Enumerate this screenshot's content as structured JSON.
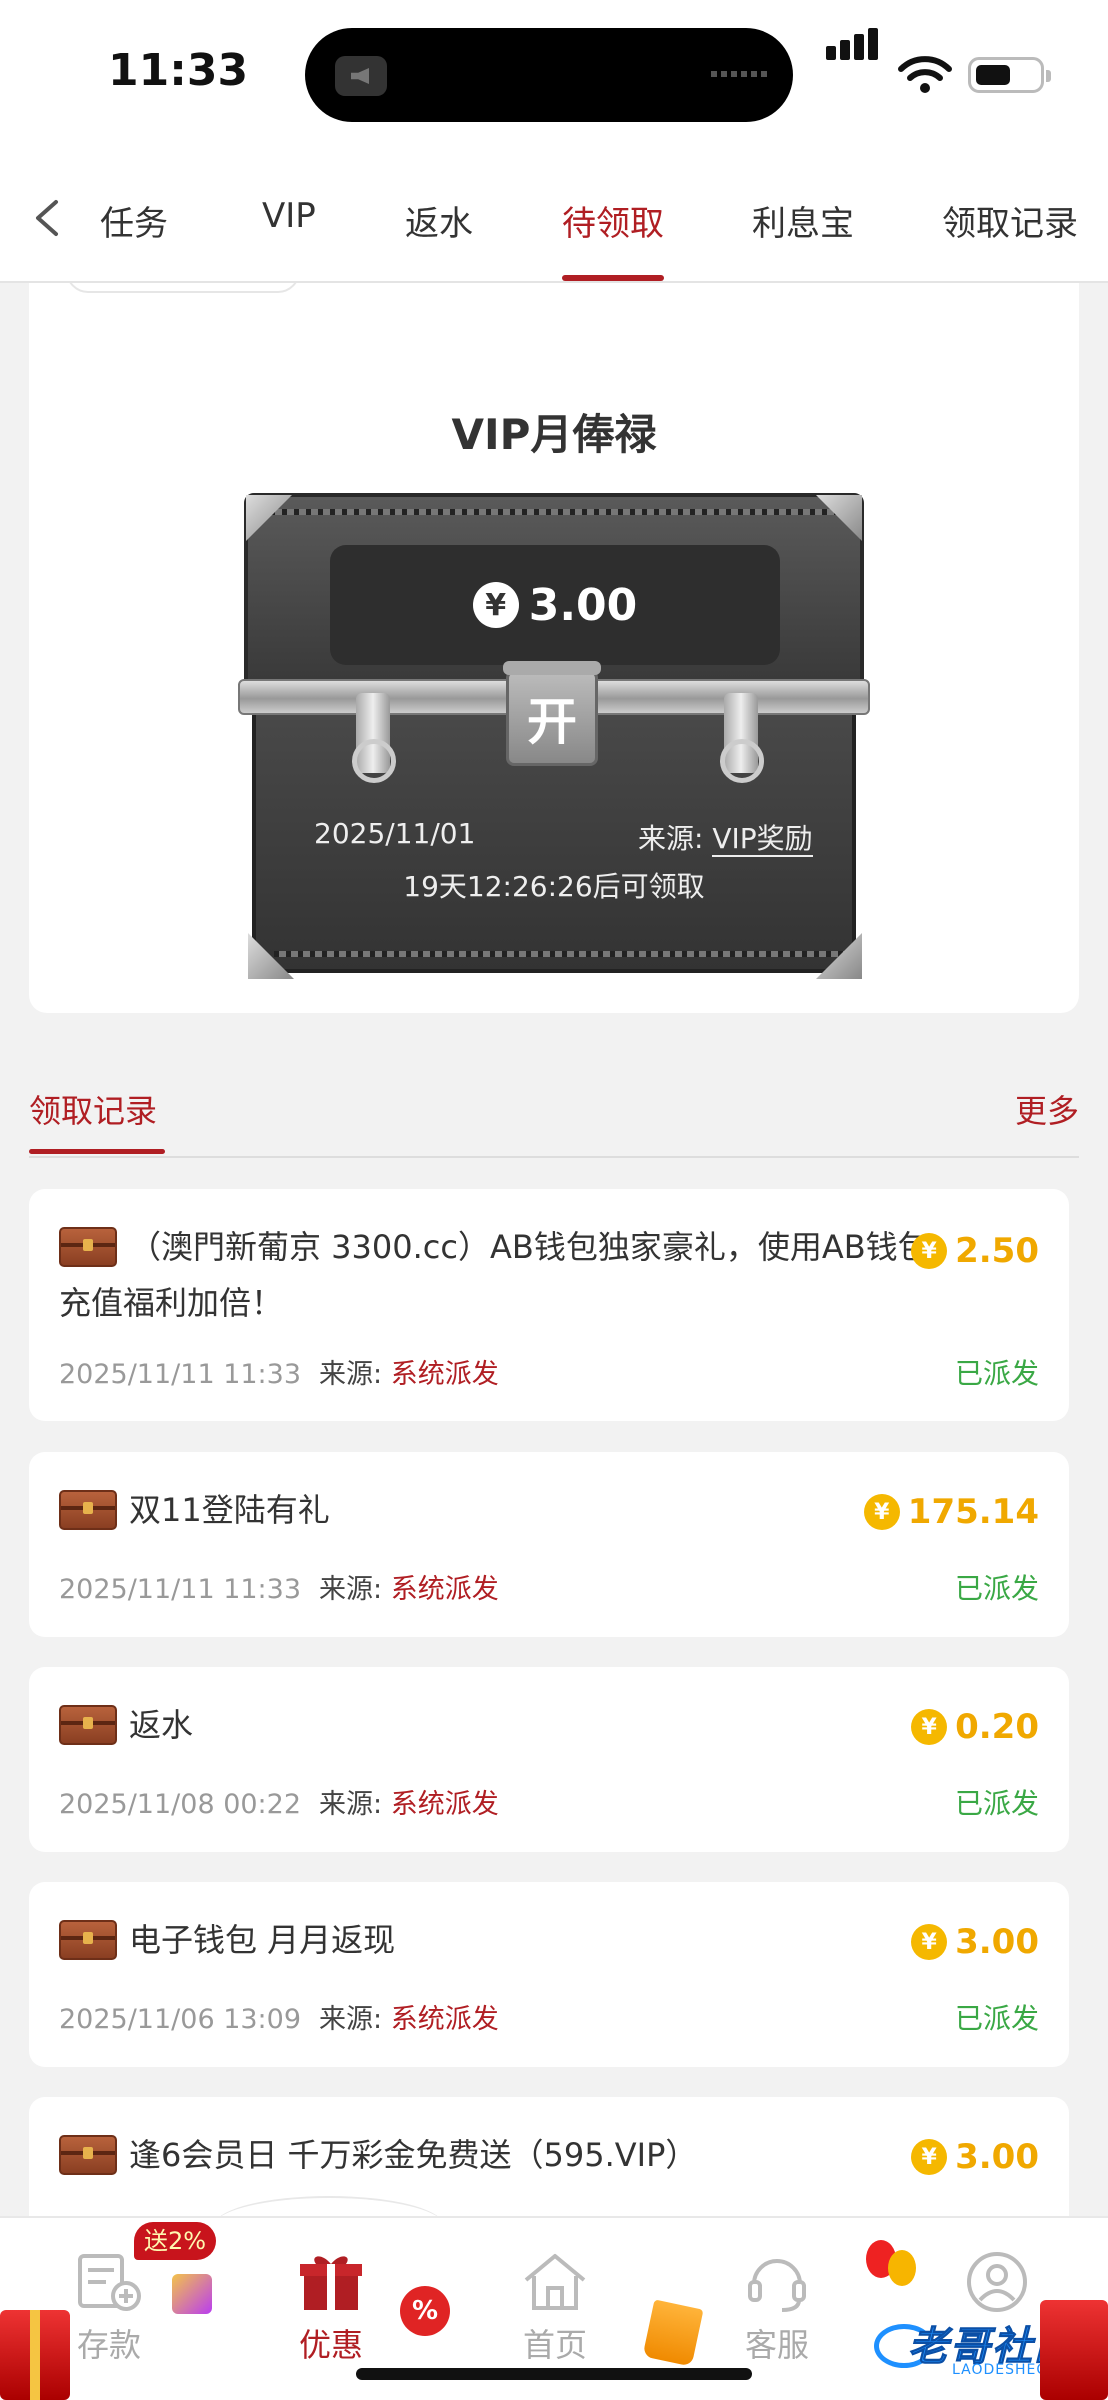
{
  "status_bar": {
    "time": "11:33"
  },
  "tabs": [
    {
      "label": "任务"
    },
    {
      "label": "VIP"
    },
    {
      "label": "返水"
    },
    {
      "label": "待领取"
    },
    {
      "label": "利息宝"
    },
    {
      "label": "领取记录"
    }
  ],
  "vip_card": {
    "title": "VIP月俸禄",
    "currency_symbol": "¥",
    "amount": "3.00",
    "open_label": "开",
    "date": "2025/11/01",
    "source_label": "来源:",
    "source_value": "VIP奖励",
    "countdown": "19天12:26:26后可领取"
  },
  "records": {
    "title": "领取记录",
    "more_label": "更多",
    "source_label": "来源:",
    "items": [
      {
        "title": "（澳門新葡京 3300.cc）AB钱包独家豪礼，使用AB钱包充值福利加倍！",
        "amount": "2.50",
        "datetime": "2025/11/11 11:33",
        "source": "系统派发",
        "status": "已派发"
      },
      {
        "title": "双11登陆有礼",
        "amount": "175.14",
        "datetime": "2025/11/11 11:33",
        "source": "系统派发",
        "status": "已派发"
      },
      {
        "title": "返水",
        "amount": "0.20",
        "datetime": "2025/11/08 00:22",
        "source": "系统派发",
        "status": "已派发"
      },
      {
        "title": "电子钱包 月月返现",
        "amount": "3.00",
        "datetime": "2025/11/06 13:09",
        "source": "系统派发",
        "status": "已派发"
      },
      {
        "title": "逢6会员日 千万彩金免费送（595.VIP）",
        "amount": "3.00"
      }
    ]
  },
  "bottom_nav": {
    "promo_badge": "送2%",
    "percent_badge": "%",
    "items": [
      {
        "label": "存款"
      },
      {
        "label": "优惠"
      },
      {
        "label": "首页"
      },
      {
        "label": "客服"
      },
      {
        "label": "我的"
      }
    ]
  },
  "watermark": {
    "text": "老哥社区",
    "sub": "LAODESHEQU"
  },
  "colors": {
    "accent": "#b01e23",
    "coin": "#f5b800",
    "status_green": "#3aa845"
  }
}
